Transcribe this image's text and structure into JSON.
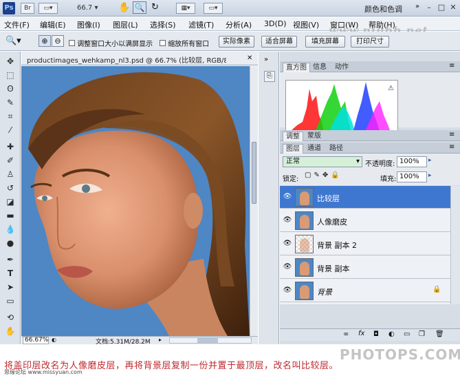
{
  "appbar": {
    "logo": "Ps",
    "zoom": "66.7",
    "workspace": "颜色和色调",
    "icons": [
      "bridge-icon",
      "minibridge-icon",
      "layout-icon",
      "hand-tool-icon",
      "zoom-tool-icon",
      "rotate-view-icon",
      "arrange-icon",
      "screen-mode-icon"
    ]
  },
  "menu": {
    "items": [
      "文件(F)",
      "编辑(E)",
      "图像(I)",
      "图层(L)",
      "选择(S)",
      "滤镜(T)",
      "分析(A)",
      "3D(D)",
      "视图(V)",
      "窗口(W)",
      "帮助(H)"
    ]
  },
  "watermark": "www.niubb.net",
  "options": {
    "resize_label": "调整窗口大小以满屏显示",
    "zoom_all_label": "缩放所有窗口",
    "actual_pixels": "实际像素",
    "fit_screen": "适合屏幕",
    "fill_screen": "填充屏幕",
    "print_size": "打印尺寸"
  },
  "document": {
    "title": "productimages_wehkamp_nl3.psd @ 66.7% (比较层, RGB/8...",
    "zoom": "66.67%",
    "doc_size": "文档:5.31M/28.2M"
  },
  "histogram_panel": {
    "tabs": [
      "直方图",
      "信息",
      "动作"
    ],
    "colors": {
      "red": "#ff2020",
      "green": "#10d010",
      "blue": "#2040ff",
      "cyan": "#00e0e0",
      "magenta": "#ff20ff",
      "yellow": "#f0f020"
    }
  },
  "adjust_panel": {
    "tabs": [
      "调整",
      "蒙版"
    ]
  },
  "layers_panel": {
    "tabs": [
      "图层",
      "通道",
      "路径"
    ],
    "blend_mode": "正常",
    "opacity_label": "不透明度:",
    "opacity_value": "100%",
    "lock_label": "锁定:",
    "fill_label": "填充:",
    "fill_value": "100%",
    "layers": [
      {
        "name": "比较层",
        "selected": true
      },
      {
        "name": "人像磨皮",
        "selected": false
      },
      {
        "name": "背景 副本 2",
        "selected": false
      },
      {
        "name": "背景 副本",
        "selected": false
      },
      {
        "name": "背景",
        "selected": false,
        "locked": true
      }
    ]
  },
  "caption": "将盖印层改名为人像磨皮层，再将背景层复制一份并置于最顶层，改名叫比较层。",
  "credit": "思缘论坛 www.missyuan.com",
  "photops": "PHOTOPS.COM"
}
